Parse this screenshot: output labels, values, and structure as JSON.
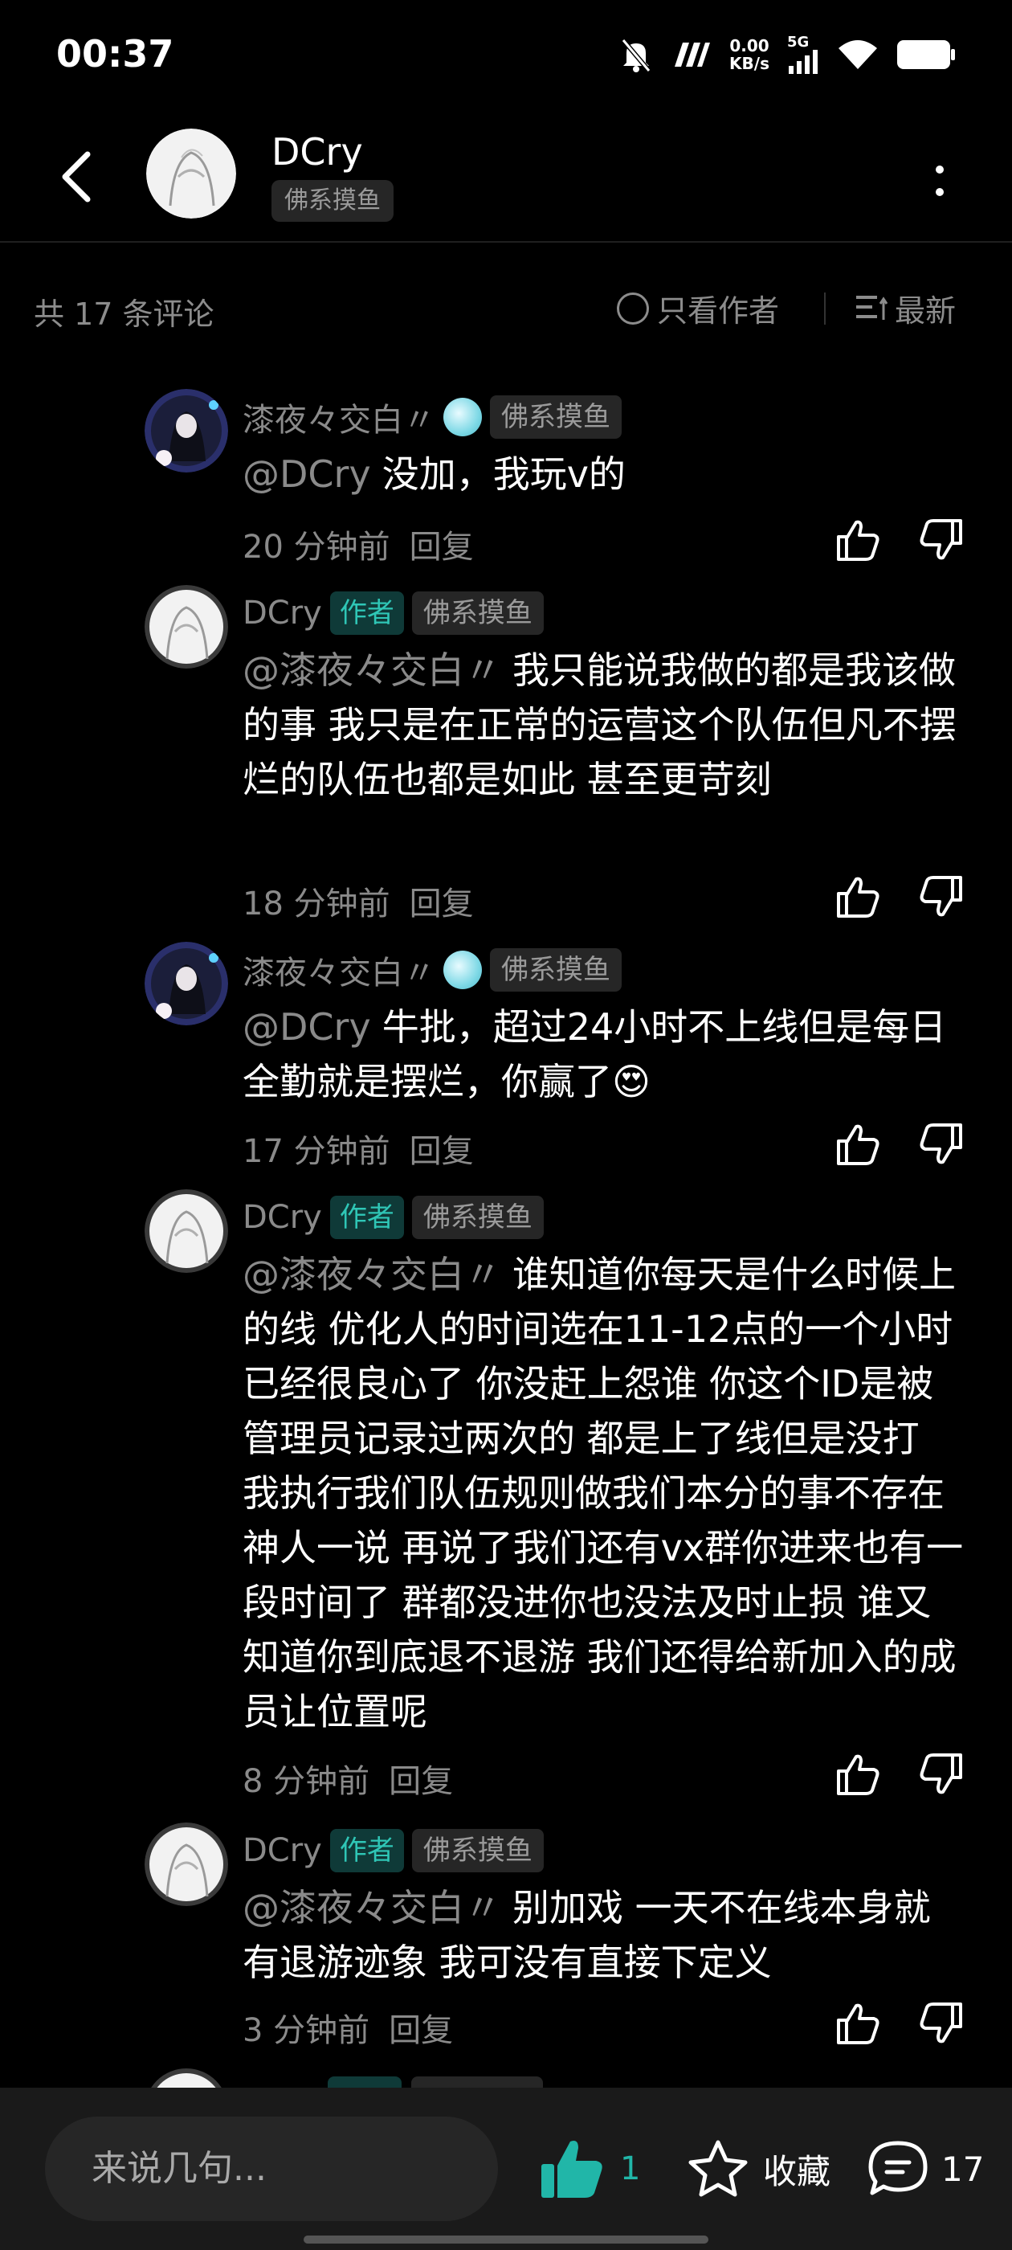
{
  "status": {
    "time": "00:37",
    "net_speed": "0.00",
    "net_unit": "KB/s",
    "signal_label": "5G"
  },
  "header": {
    "name": "DCry",
    "tag": "佛系摸鱼"
  },
  "subbar": {
    "count": "共 17 条评论",
    "author_only": "只看作者",
    "sort": "最新"
  },
  "comments": [
    {
      "user": "漆夜々交白〃",
      "is_author": false,
      "tag": "佛系摸鱼",
      "mention": "@DCry",
      "text": "没加，我玩v的",
      "time": "20 分钟前",
      "reply": "回复"
    },
    {
      "user": "DCry",
      "is_author": true,
      "author_label": "作者",
      "tag": "佛系摸鱼",
      "mention": "@漆夜々交白〃",
      "text": "我只能说我做的都是我该做的事 我只是在正常的运营这个队伍但凡不摆烂的队伍也都是如此 甚至更苛刻",
      "time": "18 分钟前",
      "reply": "回复"
    },
    {
      "user": "漆夜々交白〃",
      "is_author": false,
      "tag": "佛系摸鱼",
      "mention": "@DCry",
      "text": "牛批，超过24小时不上线但是每日全勤就是摆烂，你赢了😍",
      "time": "17 分钟前",
      "reply": "回复"
    },
    {
      "user": "DCry",
      "is_author": true,
      "author_label": "作者",
      "tag": "佛系摸鱼",
      "mention": "@漆夜々交白〃",
      "text": "谁知道你每天是什么时候上的线 优化人的时间选在11-12点的一个小时已经很良心了 你没赶上怨谁 你这个ID是被管理员记录过两次的 都是上了线但是没打 我执行我们队伍规则做我们本分的事不存在神人一说 再说了我们还有vx群你进来也有一段时间了 群都没进你也没法及时止损 谁又知道你到底退不退游 我们还得给新加入的成员让位置呢",
      "time": "8 分钟前",
      "reply": "回复"
    },
    {
      "user": "DCry",
      "is_author": true,
      "author_label": "作者",
      "tag": "佛系摸鱼",
      "mention": "@漆夜々交白〃",
      "text": "别加戏 一天不在线本身就有退游迹象 我可没有直接下定义",
      "time": "3 分钟前",
      "reply": "回复"
    }
  ],
  "bottom": {
    "input_placeholder": "来说几句...",
    "like_count": "1",
    "favorite_label": "收藏",
    "comment_count": "17"
  },
  "colors": {
    "accent": "#21b6a8",
    "background": "#000000",
    "muted_text": "#8a8a8a"
  },
  "icons": [
    "back-icon",
    "more-icon",
    "thumbs-up-icon",
    "thumbs-down-icon",
    "star-icon",
    "comment-bubble-icon",
    "sort-icon"
  ]
}
